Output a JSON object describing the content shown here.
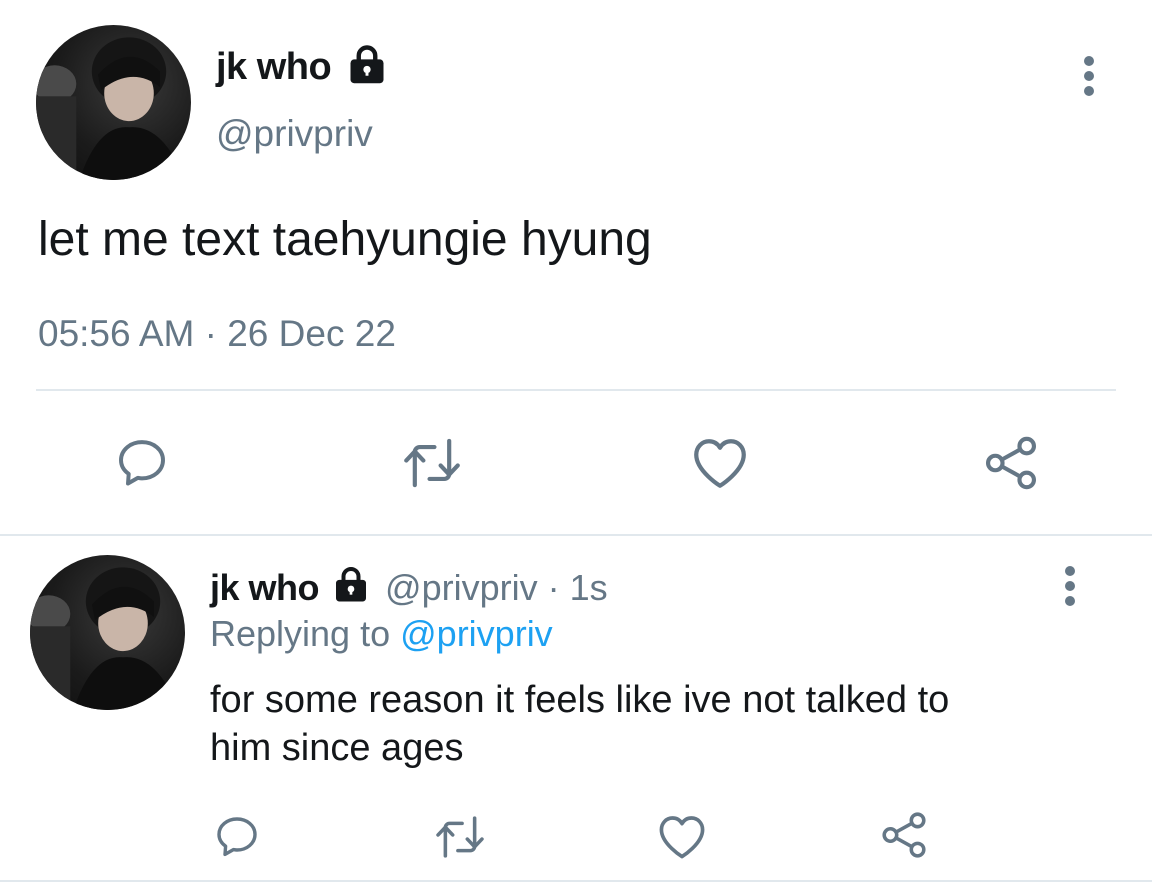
{
  "main_tweet": {
    "display_name": "jk who",
    "handle": "@privpriv",
    "text": "let me text taehyungie hyung",
    "time": "05:56 AM",
    "separator": "·",
    "date": "26 Dec 22"
  },
  "reply": {
    "display_name": "jk who",
    "handle": "@privpriv",
    "separator": "·",
    "age": "1s",
    "replying_prefix": "Replying to",
    "replying_handle": "@privpriv",
    "text_line1": "for some reason it feels like ive not talked to",
    "text_line2": "him since ages"
  },
  "icons": [
    "lock-icon",
    "more-icon",
    "reply-icon",
    "retweet-icon",
    "like-icon",
    "share-icon"
  ],
  "colors": {
    "text": "#14171a",
    "muted": "#657786",
    "link": "#1da1f2",
    "divider": "#e1e8ed"
  }
}
